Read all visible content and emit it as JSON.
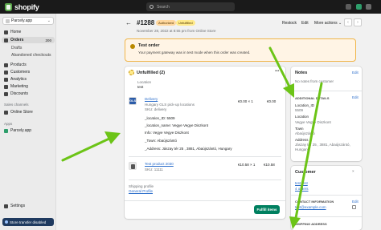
{
  "topbar": {
    "brand": "shopify",
    "search_placeholder": "Search"
  },
  "sidebar": {
    "store": "Parcely.app",
    "items": [
      {
        "label": "Home"
      },
      {
        "label": "Orders",
        "badge": "200"
      },
      {
        "label": "Drafts"
      },
      {
        "label": "Abandoned checkouts"
      },
      {
        "label": "Products"
      },
      {
        "label": "Customers"
      },
      {
        "label": "Analytics"
      },
      {
        "label": "Marketing"
      },
      {
        "label": "Discounts"
      }
    ],
    "sales_channels_label": "Sales channels",
    "online_store": "Online Store",
    "apps_label": "Apps",
    "app_item": "Parcely.app",
    "settings": "Settings",
    "banner": "Store transfer disabled"
  },
  "order": {
    "number": "#1288",
    "badges": [
      "Authorized",
      "Unfulfilled"
    ],
    "date": "November 28, 2022 at 8:55 pm from Online Store",
    "actions": [
      "Restock",
      "Edit",
      "More actions"
    ]
  },
  "notice": {
    "title": "Test order",
    "detail": "Your payment gateway was in test mode when this order was created."
  },
  "fulfillment": {
    "title": "Unfulfilled (2)",
    "location_label": "Location",
    "location_value": "test",
    "line1": {
      "name": "Delivery",
      "variant": "Hungary GLS pick-up locations",
      "sku": "SKU: delivery",
      "price": "€0.00 × 1",
      "total": "€0.00"
    },
    "attrs": [
      "_location_ID: 5509",
      "_location_name: Vegye Vegye Diszkont",
      "Info: Vegye Vegye Diszkont",
      "_Town: Abaújszántó",
      "_Address: Jászay tér 25 , 3881, Abaújszántó, Hungary"
    ],
    "line2": {
      "name": "Test product 2030",
      "sku": "SKU: 11111",
      "price": "€10.58 × 1",
      "total": "€10.58"
    },
    "shipping_label": "Shipping profile",
    "shipping_value": "General Profile",
    "fulfill_button": "Fulfill items"
  },
  "notes": {
    "title": "Notes",
    "edit": "Edit",
    "empty": "No notes from customer"
  },
  "additional": {
    "title": "ADDITIONAL DETAILS",
    "edit": "Edit",
    "fields": [
      {
        "k": "Location_ID",
        "v": "5509"
      },
      {
        "k": "Location",
        "v": "Vegye Vegye Diszkont"
      },
      {
        "k": "Town",
        "v": "Abaújszántó"
      },
      {
        "k": "Address",
        "v": "Jászay tér 25 , 3881, Abaújszántó, Hungary"
      }
    ]
  },
  "customer": {
    "title": "Customer",
    "name": "test test",
    "orders": "4 orders",
    "contact_label": "CONTACT INFORMATION",
    "edit": "Edit",
    "email": "test@example.com",
    "shipping_label": "SHIPPING ADDRESS"
  },
  "colors": {
    "arrow": "#6cc417",
    "accent": "#008060",
    "topbar": "#1a1a1a"
  }
}
